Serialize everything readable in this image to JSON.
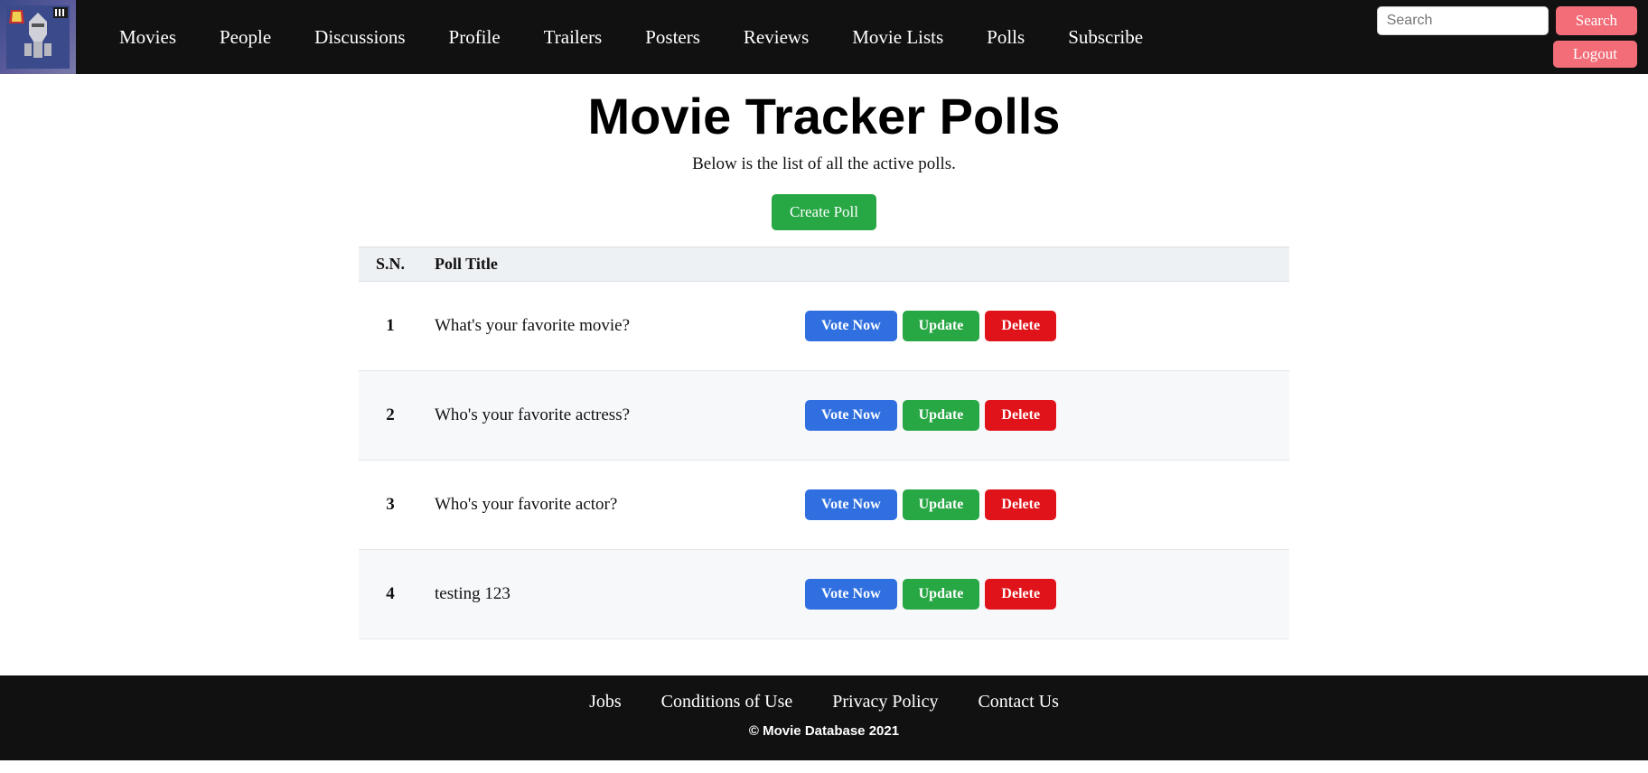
{
  "nav": {
    "items": [
      "Movies",
      "People",
      "Discussions",
      "Profile",
      "Trailers",
      "Posters",
      "Reviews",
      "Movie Lists",
      "Polls",
      "Subscribe"
    ],
    "search_placeholder": "Search",
    "search_button": "Search",
    "logout_button": "Logout"
  },
  "page": {
    "title": "Movie Tracker Polls",
    "subtitle": "Below is the list of all the active polls.",
    "create_button": "Create Poll"
  },
  "table": {
    "headers": {
      "sn": "S.N.",
      "title": "Poll Title"
    },
    "rows": [
      {
        "sn": "1",
        "title": "What's your favorite movie?"
      },
      {
        "sn": "2",
        "title": "Who's your favorite actress?"
      },
      {
        "sn": "3",
        "title": "Who's your favorite actor?"
      },
      {
        "sn": "4",
        "title": "testing 123"
      }
    ],
    "actions": {
      "vote": "Vote Now",
      "update": "Update",
      "delete": "Delete"
    }
  },
  "footer": {
    "links": [
      "Jobs",
      "Conditions of Use",
      "Privacy Policy",
      "Contact Us"
    ],
    "copyright": "© Movie Database 2021"
  }
}
